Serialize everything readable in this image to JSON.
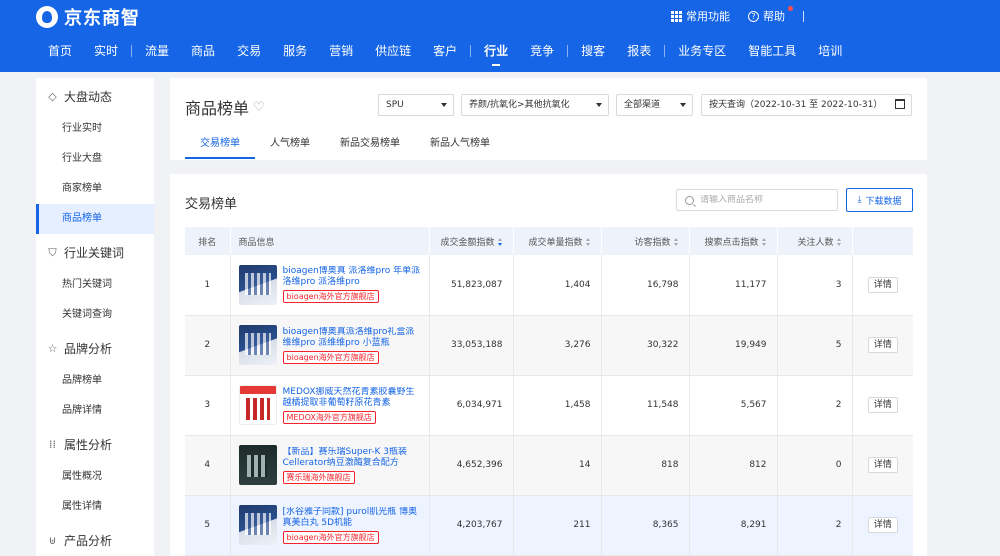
{
  "header": {
    "logo_text": "京东商智",
    "common_label": "常用功能",
    "help_label": "帮助",
    "nav": [
      {
        "label": "首页"
      },
      {
        "label": "实时"
      },
      {
        "label": "流量"
      },
      {
        "label": "商品"
      },
      {
        "label": "交易"
      },
      {
        "label": "服务"
      },
      {
        "label": "营销"
      },
      {
        "label": "供应链"
      },
      {
        "label": "客户"
      },
      {
        "label": "行业"
      },
      {
        "label": "竞争"
      },
      {
        "label": "搜客"
      },
      {
        "label": "报表"
      },
      {
        "label": "业务专区"
      },
      {
        "label": "智能工具"
      },
      {
        "label": "培训"
      }
    ],
    "active_nav": "行业"
  },
  "sidebar": {
    "groups": [
      {
        "title": "大盘动态",
        "icon": "compass-icon",
        "items": [
          "行业实时",
          "行业大盘",
          "商家榜单",
          "商品榜单"
        ]
      },
      {
        "title": "行业关键词",
        "icon": "shield-icon",
        "items": [
          "热门关键词",
          "关键词查询"
        ]
      },
      {
        "title": "品牌分析",
        "icon": "star-icon",
        "items": [
          "品牌榜单",
          "品牌详情"
        ]
      },
      {
        "title": "属性分析",
        "icon": "bars-icon",
        "items": [
          "属性概况",
          "属性详情"
        ]
      },
      {
        "title": "产品分析",
        "icon": "cart-icon",
        "items": []
      }
    ],
    "active_item": "商品榜单"
  },
  "filters": {
    "page_title": "商品榜单",
    "spu": "SPU",
    "category": "养颜/抗氧化>其他抗氧化",
    "channel": "全部渠道",
    "date": "按天查询（2022-10-31 至 2022-10-31）"
  },
  "tabs": [
    "交易榜单",
    "人气榜单",
    "新品交易榜单",
    "新品人气榜单"
  ],
  "active_tab": "交易榜单",
  "table": {
    "title": "交易榜单",
    "search_placeholder": "请输入商品名称",
    "download_label": "下载数据",
    "columns": [
      "排名",
      "商品信息",
      "成交金额指数",
      "成交单量指数",
      "访客指数",
      "搜索点击指数",
      "关注人数"
    ],
    "detail_label": "详情",
    "rows": [
      {
        "rank": "1",
        "name": "bioagen博奥真 派洛维pro 年单派洛维pro 派洛维pro",
        "shop": "bioagen海外官方旗舰店",
        "amount": "51,823,087",
        "orders": "1,404",
        "visitors": "16,798",
        "search": "11,177",
        "follows": "3",
        "thumb": "navy"
      },
      {
        "rank": "2",
        "name": "bioagen博奥真派洛维pro礼盒派维维pro 派维维pro 小蓝瓶",
        "shop": "bioagen海外官方旗舰店",
        "amount": "33,053,188",
        "orders": "3,276",
        "visitors": "30,322",
        "search": "19,949",
        "follows": "5",
        "thumb": "navy"
      },
      {
        "rank": "3",
        "name": "MEDOX挪威天然花青素胶囊野生越橘提取非葡萄籽原花青素",
        "shop": "MEDOX海外官方旗舰店",
        "amount": "6,034,971",
        "orders": "1,458",
        "visitors": "11,548",
        "search": "5,567",
        "follows": "2",
        "thumb": "red"
      },
      {
        "rank": "4",
        "name": "【新品】赛乐瑞Super-K 3瓶装Cellerator纳豆激酶复合配方",
        "shop": "赛乐瑞海外旗舰店",
        "amount": "4,652,396",
        "orders": "14",
        "visitors": "818",
        "search": "812",
        "follows": "0",
        "thumb": "dark"
      },
      {
        "rank": "5",
        "name": "[水谷雅子同款] purol肌光瓶 博奥真美白丸 5D机能",
        "shop": "bioagen海外官方旗舰店",
        "amount": "4,203,767",
        "orders": "211",
        "visitors": "8,365",
        "search": "8,291",
        "follows": "2",
        "thumb": "navy"
      }
    ]
  }
}
